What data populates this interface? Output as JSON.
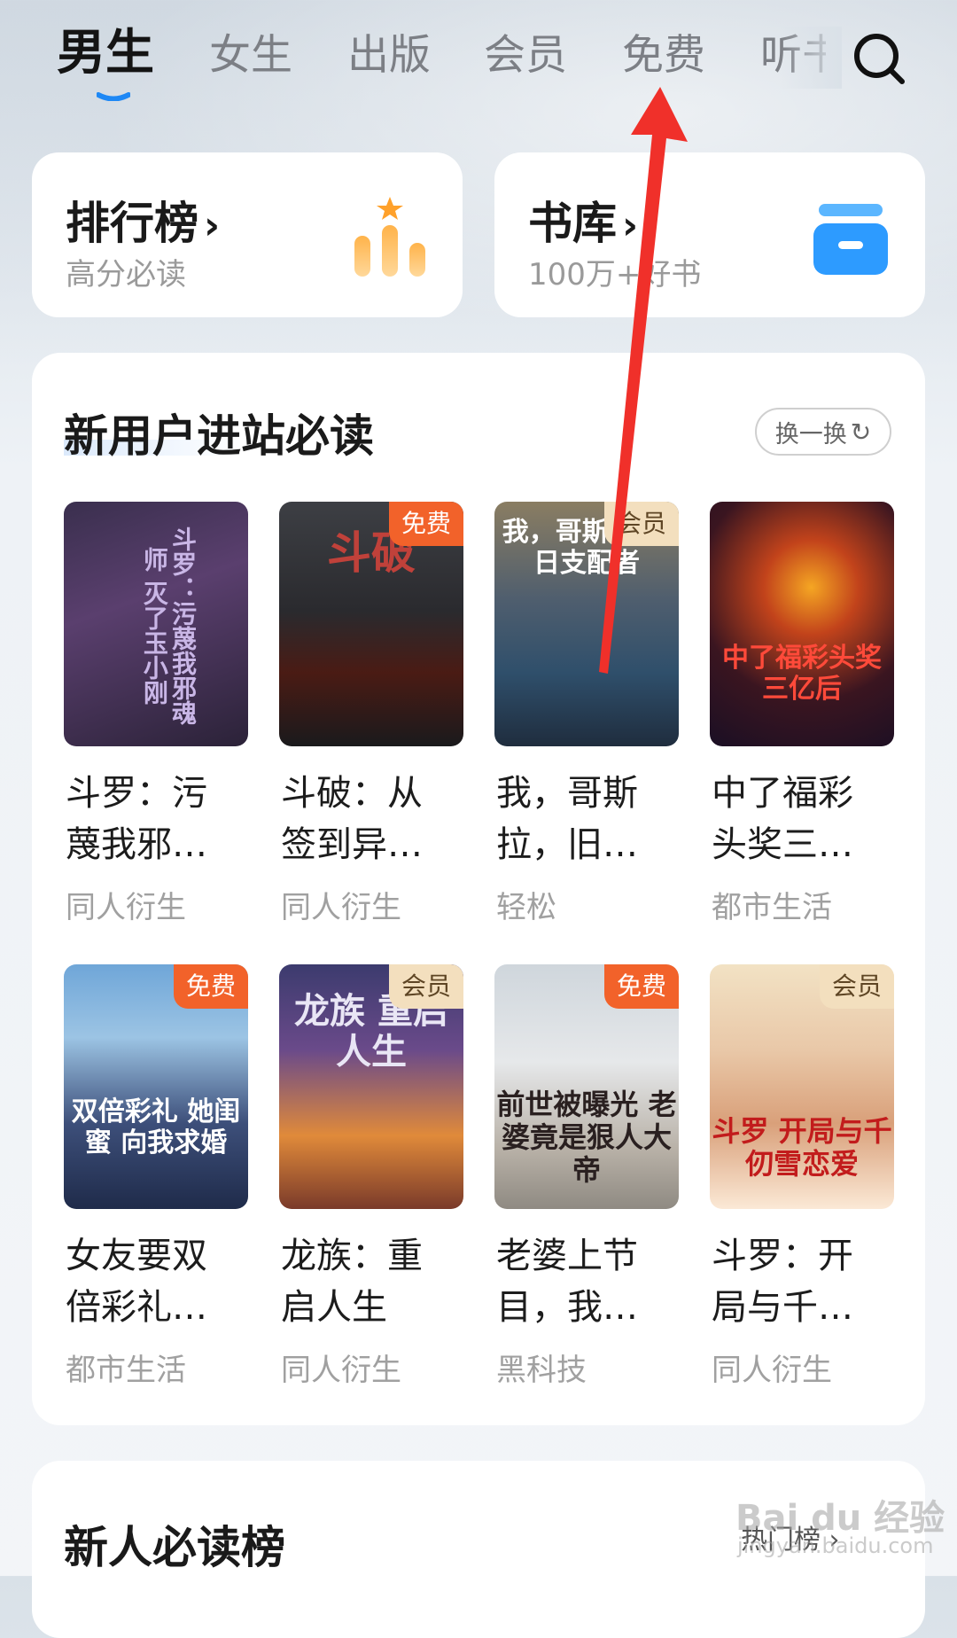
{
  "tabs": [
    "男生",
    "女生",
    "出版",
    "会员",
    "免费",
    "听书"
  ],
  "active_tab": "男生",
  "top_cards": [
    {
      "title": "排行榜",
      "subtitle": "高分必读"
    },
    {
      "title": "书库",
      "subtitle": "100万+好书"
    }
  ],
  "section": {
    "title": "新用户进站必读",
    "refresh_label": "换一换",
    "books": [
      {
        "title_line1": "斗罗：污",
        "title_line2": "蔑我邪…",
        "genre": "同人衍生",
        "badge": "",
        "cover_text": "斗罗：污蔑我邪魂师 灭了玉小刚"
      },
      {
        "title_line1": "斗破：从",
        "title_line2": "签到异…",
        "genre": "同人衍生",
        "badge": "免费",
        "cover_text": "斗破"
      },
      {
        "title_line1": "我，哥斯",
        "title_line2": "拉，旧…",
        "genre": "轻松",
        "badge": "会员",
        "cover_text": "我，哥斯拉 旧日支配者"
      },
      {
        "title_line1": "中了福彩",
        "title_line2": "头奖三…",
        "genre": "都市生活",
        "badge": "",
        "cover_text": "中了福彩头奖三亿后"
      },
      {
        "title_line1": "女友要双",
        "title_line2": "倍彩礼…",
        "genre": "都市生活",
        "badge": "免费",
        "cover_text": "双倍彩礼 她闺蜜 向我求婚"
      },
      {
        "title_line1": "龙族：重",
        "title_line2": "启人生",
        "genre": "同人衍生",
        "badge": "会员",
        "cover_text": "龙族 重启人生"
      },
      {
        "title_line1": "老婆上节",
        "title_line2": "目，我…",
        "genre": "黑科技",
        "badge": "免费",
        "cover_text": "前世被曝光 老婆竟是狠人大帝"
      },
      {
        "title_line1": "斗罗：开",
        "title_line2": "局与千…",
        "genre": "同人衍生",
        "badge": "会员",
        "cover_text": "斗罗 开局与千仞雪恋爱"
      }
    ]
  },
  "section2": {
    "title": "新人必读榜",
    "hot_label": "热门榜 ›"
  },
  "watermark": {
    "main": "Bai du 经验",
    "sub": "jingyan.baidu.com"
  },
  "colors": {
    "accent_blue": "#1e88f5",
    "free_badge": "#f2622a",
    "vip_badge": "#f3dfbe",
    "arrow": "#f0302a"
  }
}
